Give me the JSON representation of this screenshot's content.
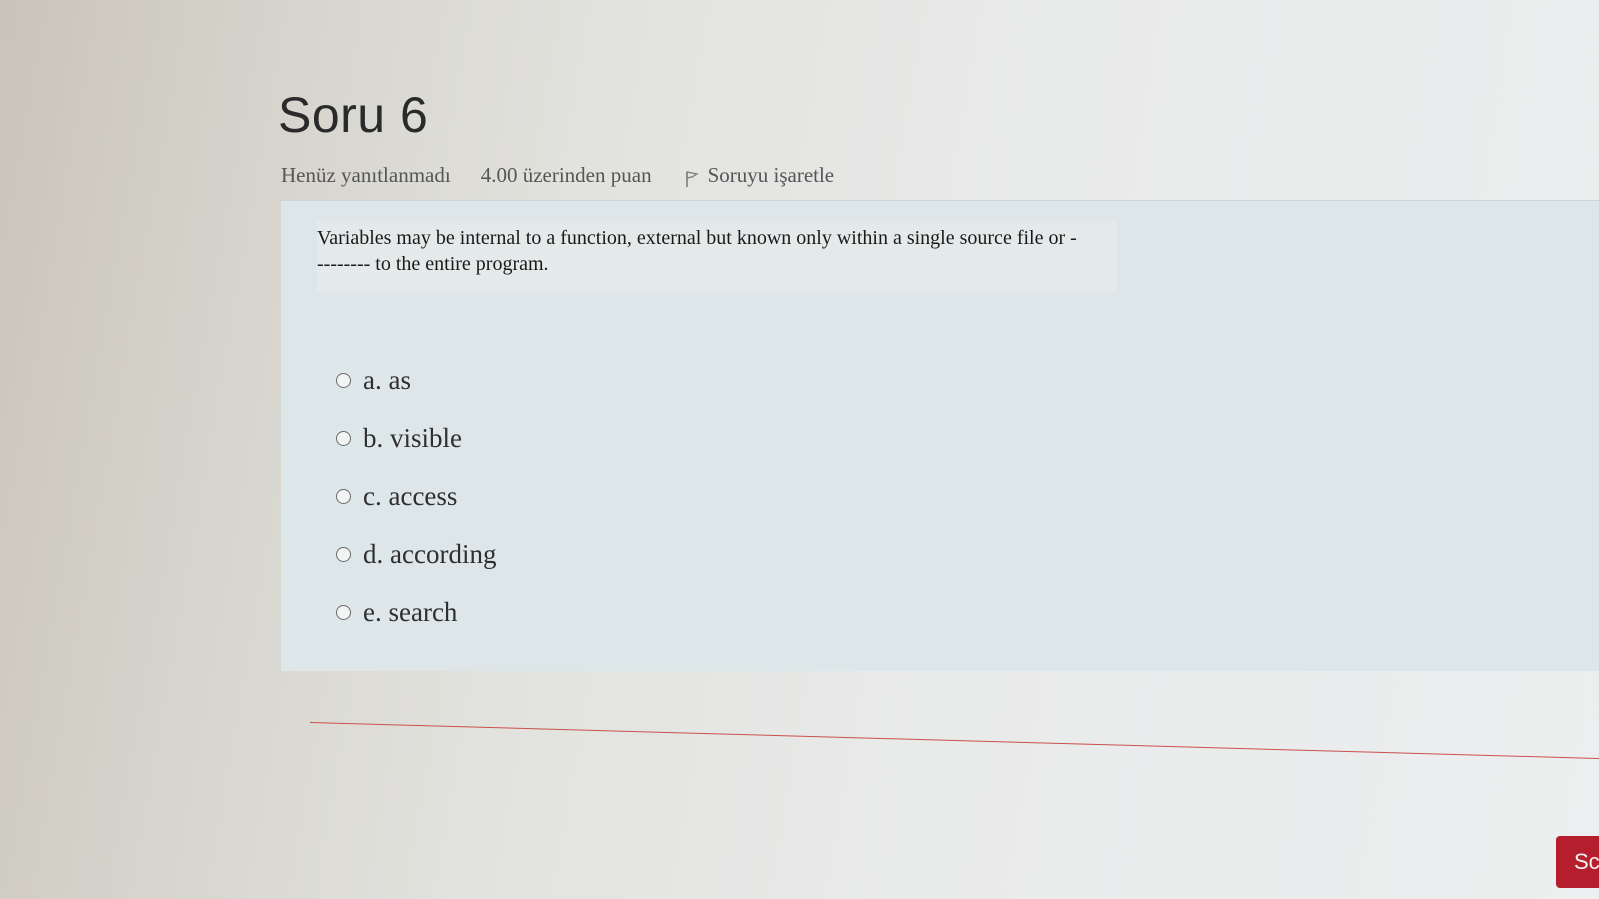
{
  "question": {
    "title": "Soru 6",
    "state": "Henüz yanıtlanmadı",
    "grade": "4.00 üzerinden puan",
    "flag_label": "Soruyu işaretle",
    "text_line1": "Variables may be internal to a function, external but known only within a single source file or -",
    "text_line2": "-------- to the entire program.",
    "answers": [
      {
        "label": "a. as"
      },
      {
        "label": "b. visible"
      },
      {
        "label": "c. access"
      },
      {
        "label": "d.  according"
      },
      {
        "label": "e. search"
      }
    ]
  },
  "navigation": {
    "next_label": "Sc"
  },
  "colors": {
    "accent": "#b51f2d",
    "formulation_bg": "#dde7ea",
    "divider": "#c9514d"
  },
  "icons": {
    "flag": "flag-icon",
    "radio": "radio-unchecked"
  }
}
